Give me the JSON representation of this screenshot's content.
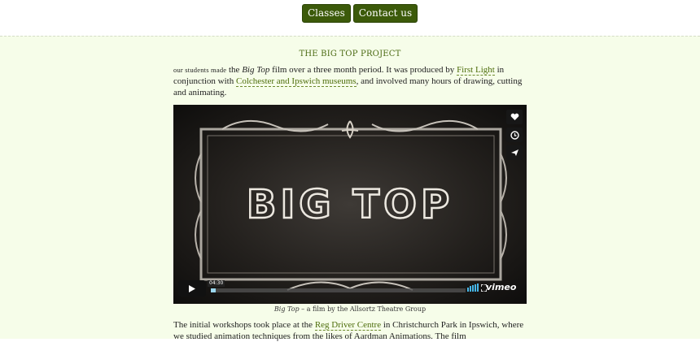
{
  "nav": {
    "classes": "Classes",
    "contact": "Contact us"
  },
  "section": {
    "title": "THE BIG TOP PROJECT"
  },
  "intro": {
    "lead": "our students made",
    "t1": " the ",
    "film": "Big Top",
    "t2": " film over a three month period. It was produced by ",
    "link1": "First Light",
    "t3": " in conjunction with ",
    "link2": "Colchester and Ipswich museums",
    "t4": ", and involved many hours of drawing, cutting and animating."
  },
  "video": {
    "title_text": "BIG TOP",
    "time": "04:30",
    "progress": 0.02,
    "brand": "vimeo",
    "icons": {
      "like": "heart-icon",
      "later": "clock-icon",
      "share": "send-icon",
      "play": "play-icon"
    }
  },
  "caption": {
    "title": "Big Top",
    "rest": " – a film by the Allsortz Theatre Group"
  },
  "body2": {
    "t1": "The initial workshops took place at the ",
    "link": "Reg Driver Centre",
    "t2": " in Christchurch Park in Ipswich, where we studied animation techniques from the likes of Aardman Animations. The film"
  },
  "colors": {
    "accent": "#3c5a0a",
    "link": "#4e6d0c",
    "background": "#f6fde9",
    "progress": "#9ad6ee"
  }
}
